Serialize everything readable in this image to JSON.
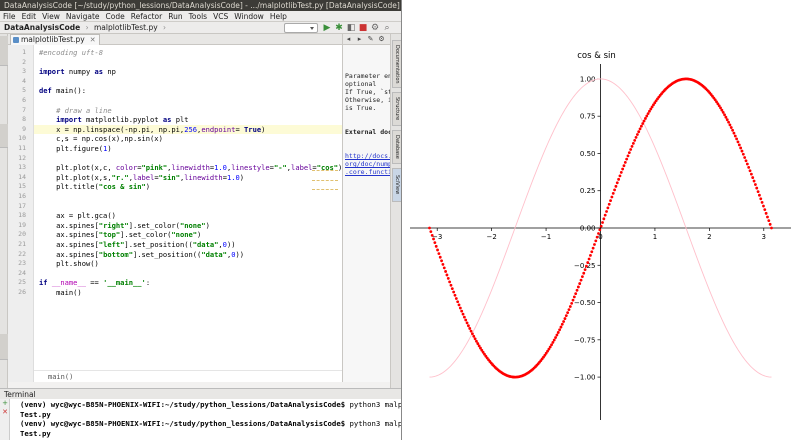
{
  "window": {
    "title": "DataAnalysisCode [~/study/python_lessions/DataAnalysisCode] - .../malplotlibTest.py [DataAnalysisCode] - PyCharm"
  },
  "menu": [
    {
      "label": "File"
    },
    {
      "label": "Edit"
    },
    {
      "label": "View"
    },
    {
      "label": "Navigate"
    },
    {
      "label": "Code"
    },
    {
      "label": "Refactor"
    },
    {
      "label": "Run"
    },
    {
      "label": "Tools"
    },
    {
      "label": "VCS"
    },
    {
      "label": "Window"
    },
    {
      "label": "Help"
    }
  ],
  "breadcrumbs": [
    "DataAnalysisCode",
    "malplotlibTest.py"
  ],
  "editor": {
    "tab_label": "malplotlibTest.py",
    "highlight_line": 9,
    "breadcrumb_footer": "main()",
    "lines": [
      {
        "n": "1",
        "html": "<span class='c-com'>#encoding uft-8</span>"
      },
      {
        "n": "2",
        "html": ""
      },
      {
        "n": "3",
        "html": "<span class='c-kw'>import</span> numpy <span class='c-kw'>as</span> np"
      },
      {
        "n": "4",
        "html": ""
      },
      {
        "n": "5",
        "html": "<span class='c-kw'>def</span> main():"
      },
      {
        "n": "6",
        "html": ""
      },
      {
        "n": "7",
        "html": "    <span class='c-com'># draw a line</span>"
      },
      {
        "n": "8",
        "html": "    <span class='c-kw'>import</span> matplotlib.pyplot <span class='c-kw'>as</span> plt"
      },
      {
        "n": "9",
        "html": "    x = np.linspace(-np.pi, np.pi,<span class='c-num'>256</span>,<span class='c-kwarg'>endpoint</span>= <span class='c-kw'>True</span>)"
      },
      {
        "n": "10",
        "html": "    c,s = np.cos(x),np.sin(x)"
      },
      {
        "n": "11",
        "html": "    plt.figure(<span class='c-num'>1</span>)"
      },
      {
        "n": "12",
        "html": ""
      },
      {
        "n": "13",
        "html": "    plt.plot(x,c, <span class='c-kwarg'>color</span>=<span class='c-str'>\"pink\"</span>,<span class='c-kwarg'>linewidth</span>=<span class='c-num'>1.0</span>,<span class='c-kwarg'>linestyle</span>=<span class='c-str'>\"-\"</span>,<span class='c-kwarg'>label</span>=<span class='c-str'>\"cos\"</span>)"
      },
      {
        "n": "14",
        "html": "    plt.plot(x,s,<span class='c-str'>\"r.\"</span>,<span class='c-kwarg'>label</span>=<span class='c-str'>\"sin\"</span>,<span class='c-kwarg'>linewidth</span>=<span class='c-num'>1.0</span>)"
      },
      {
        "n": "15",
        "html": "    plt.title(<span class='c-str'>\"cos &amp; sin\"</span>)"
      },
      {
        "n": "16",
        "html": ""
      },
      {
        "n": "17",
        "html": ""
      },
      {
        "n": "18",
        "html": "    ax = plt.gca()"
      },
      {
        "n": "19",
        "html": "    ax.spines[<span class='c-str'>\"right\"</span>].set_color(<span class='c-str'>\"none\"</span>)"
      },
      {
        "n": "20",
        "html": "    ax.spines[<span class='c-str'>\"top\"</span>].set_color(<span class='c-str'>\"none\"</span>)"
      },
      {
        "n": "21",
        "html": "    ax.spines[<span class='c-str'>\"left\"</span>].set_position((<span class='c-str'>\"data\"</span>,<span class='c-num'>0</span>))"
      },
      {
        "n": "22",
        "html": "    ax.spines[<span class='c-str'>\"bottom\"</span>].set_position((<span class='c-str'>\"data\"</span>,<span class='c-num'>0</span>))"
      },
      {
        "n": "23",
        "html": "    plt.show()"
      },
      {
        "n": "24",
        "html": ""
      },
      {
        "n": "25",
        "html": "<span class='c-kw'>if</span> <span class='c-dunder'>__name__</span> == <span class='c-str'>'__main__'</span>:"
      },
      {
        "n": "26",
        "html": "    main()"
      }
    ]
  },
  "docs": {
    "text": "Parameter enc\noptional\nIf True, `stop\nOtherwise, it\nis True.",
    "heading": "External doc",
    "link": "http://docs.sc\norg/doc/numpy/\n.core.function"
  },
  "right_tabs": [
    "Documentation",
    "Structure",
    "Database",
    "SciView"
  ],
  "terminal": {
    "header": "Terminal",
    "lines": [
      {
        "prompt": "(venv) wyc@wyc-B85N-PHOENIX-WIFI:",
        "path": "~/study/python_lessions/DataAnalysisCode$",
        "cmd": " python3 malplotlib"
      },
      {
        "prompt": "Test.py",
        "path": "",
        "cmd": ""
      },
      {
        "prompt": "(venv) wyc@wyc-B85N-PHOENIX-WIFI:",
        "path": "~/study/python_lessions/DataAnalysisCode$",
        "cmd": " python3 malplotlib"
      },
      {
        "prompt": "Test.py",
        "path": "",
        "cmd": ""
      }
    ]
  },
  "chart_data": {
    "type": "line",
    "title": "cos & sin",
    "xlabel": "",
    "ylabel": "",
    "xlim": [
      -3.5,
      3.5
    ],
    "ylim": [
      -1.1,
      1.1
    ],
    "x_ticks": [
      -3,
      -2,
      -1,
      0,
      1,
      2,
      3
    ],
    "x_tick_labels": [
      "−3",
      "−2",
      "−1",
      "0",
      "1",
      "2",
      "3"
    ],
    "y_ticks": [
      -1.0,
      -0.75,
      -0.5,
      -0.25,
      0.0,
      0.25,
      0.5,
      0.75,
      1.0
    ],
    "y_tick_labels": [
      "−1.00",
      "−0.75",
      "−0.50",
      "−0.25",
      "0.00",
      "0.25",
      "0.50",
      "0.75",
      "1.00"
    ],
    "spines": "centered at data (0,0)",
    "series": [
      {
        "function": "cos",
        "x_range": [
          -3.14159,
          3.14159
        ],
        "points": 256,
        "color": "#ffc0cb",
        "style": "line"
      },
      {
        "function": "sin",
        "x_range": [
          -3.14159,
          3.14159
        ],
        "points": 256,
        "color": "#ff0000",
        "style": "dots"
      }
    ]
  }
}
